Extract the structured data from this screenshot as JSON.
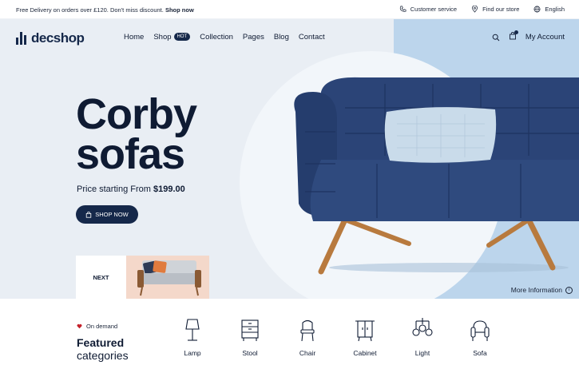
{
  "topbar": {
    "promo_text": "Free Delivery on orders over £120. Don't miss discount.",
    "promo_link": "Shop now",
    "customer_service": "Customer service",
    "find_store": "Find our store",
    "language": "English"
  },
  "brand": {
    "name": "decshop"
  },
  "nav": {
    "home": "Home",
    "shop": "Shop",
    "hot_badge": "HOT",
    "collection": "Collection",
    "pages": "Pages",
    "blog": "Blog",
    "contact": "Contact"
  },
  "account": {
    "label": "My Account"
  },
  "hero": {
    "title_line1": "Corby",
    "title_line2": "sofas",
    "price_prefix": "Price starting From",
    "price_value": "$199.00",
    "cta_label": "SHOP NOW",
    "next_label": "NEXT",
    "more_info": "More Information",
    "info_glyph": "i"
  },
  "featured": {
    "tag": "On demand",
    "title_line1": "Featured",
    "title_line2": "categories",
    "categories": [
      {
        "label": "Lamp",
        "icon": "lamp-icon"
      },
      {
        "label": "Stool",
        "icon": "stool-icon"
      },
      {
        "label": "Chair",
        "icon": "chair-icon"
      },
      {
        "label": "Cabinet",
        "icon": "cabinet-icon"
      },
      {
        "label": "Light",
        "icon": "light-icon"
      },
      {
        "label": "Sofa",
        "icon": "sofa-icon"
      }
    ]
  },
  "colors": {
    "navy": "#15284a",
    "hero_bg": "#e9eef4",
    "hero_blue": "#bcd5ec",
    "sofa": "#2b4477",
    "pillow": "#c9dbea",
    "wood": "#b87a3e",
    "heart": "#c4212b"
  }
}
